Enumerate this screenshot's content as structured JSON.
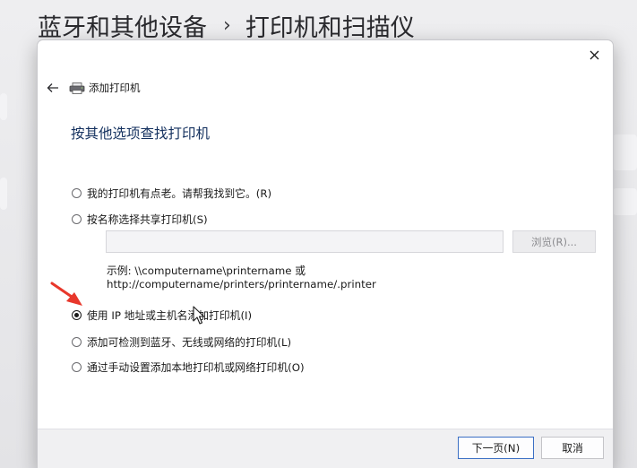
{
  "background": {
    "breadcrumb": {
      "parent": "蓝牙和其他设备",
      "separator": "›",
      "current": "打印机和扫描仪"
    }
  },
  "dialog": {
    "close_icon": "close-icon",
    "back_icon": "back-arrow-icon",
    "wizard_icon": "printer-icon",
    "title": "添加打印机",
    "heading": "按其他选项查找打印机",
    "options": [
      {
        "label": "我的打印机有点老。请帮我找到它。(R)",
        "checked": false
      },
      {
        "label": "按名称选择共享打印机(S)",
        "checked": false
      },
      {
        "label": "使用 IP 地址或主机名添加打印机(I)",
        "checked": true
      },
      {
        "label": "添加可检测到蓝牙、无线或网络的打印机(L)",
        "checked": false
      },
      {
        "label": "通过手动设置添加本地打印机或网络打印机(O)",
        "checked": false
      }
    ],
    "shared_printer_input": {
      "value": "",
      "placeholder": ""
    },
    "browse_button": "浏览(R)...",
    "example_line1": "示例: \\\\computername\\printername 或",
    "example_line2": "http://computername/printers/printername/.printer",
    "next_button": "下一页(N)",
    "cancel_button": "取消"
  },
  "colors": {
    "heading": "#14315f",
    "primary_border": "#3b6fc4",
    "annotation_arrow": "#e8372b"
  }
}
